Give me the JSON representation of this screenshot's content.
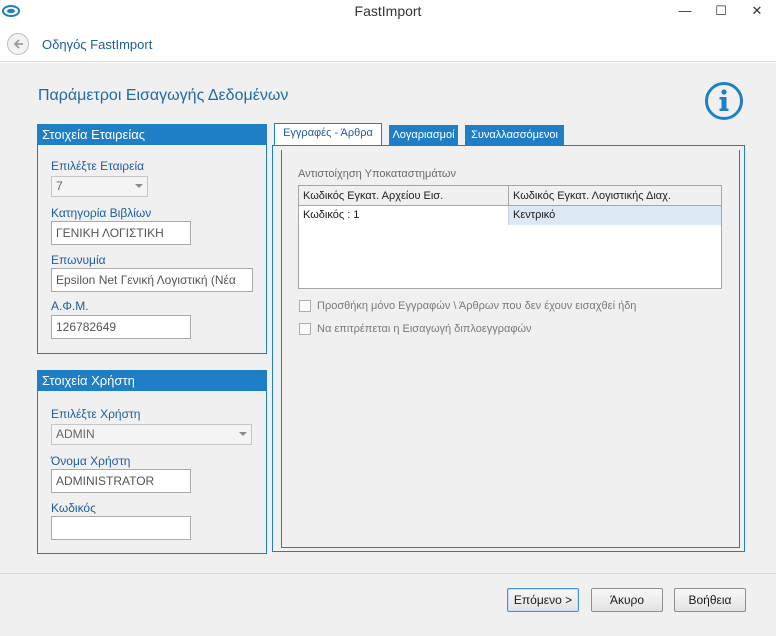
{
  "window": {
    "title": "FastImport",
    "minimize_glyph": "—",
    "maximize_glyph": "☐",
    "close_glyph": "✕",
    "icon": "swirl-app-icon"
  },
  "nav": {
    "back_icon": "arrow-left-icon",
    "title": "Οδηγός FastImport"
  },
  "page": {
    "title": "Παράμετροι Εισαγωγής Δεδομένων",
    "info_icon": "info-circle-icon"
  },
  "company": {
    "header": "Στοιχεία Εταιρείας",
    "select_label": "Επιλέξτε Εταιρεία",
    "select_value": "7",
    "books_label": "Κατηγορία Βιβλίων",
    "books_value": "ΓΕΝΙΚΗ ΛΟΓΙΣΤΙΚΗ",
    "name_label": "Επωνυμία",
    "name_value": "Epsilon Net Γενική Λογιστική (Νέα",
    "afm_label": "Α.Φ.Μ.",
    "afm_value": "126782649"
  },
  "user": {
    "header": "Στοιχεία Χρήστη",
    "select_label": "Επιλέξτε Χρήστη",
    "select_value": "ADMIN",
    "username_label": "Όνομα Χρήστη",
    "username_value": "ADMINISTRATOR",
    "password_label": "Κωδικός",
    "password_value": ""
  },
  "tabs": [
    {
      "label": "Εγγραφές - Άρθρα",
      "active": true
    },
    {
      "label": "Λογαριασμοί",
      "active": false
    },
    {
      "label": "Συναλλασσόμενοι",
      "active": false
    }
  ],
  "mapping": {
    "section_label": "Αντιστοίχηση Υποκαταστημάτων",
    "columns": [
      "Κωδικός Εγκατ. Αρχείου Εισ.",
      "Κωδικός Εγκατ. Λογιστικής Διαχ."
    ],
    "rows": [
      [
        "Κωδικός : 1",
        "Κεντρικό"
      ]
    ]
  },
  "options": {
    "only_new": "Προσθήκη μόνο Εγγραφών \\ Άρθρων που δεν έχουν εισαχθεί ήδη",
    "allow_duplicates": "Να επιτρέπεται η Εισαγωγή διπλοεγγραφών"
  },
  "footer": {
    "next": "Επόμενο >",
    "cancel": "Άκυρο",
    "help": "Βοήθεια"
  },
  "colors": {
    "accent": "#1e7fc6",
    "title_blue": "#1f6aa8"
  }
}
